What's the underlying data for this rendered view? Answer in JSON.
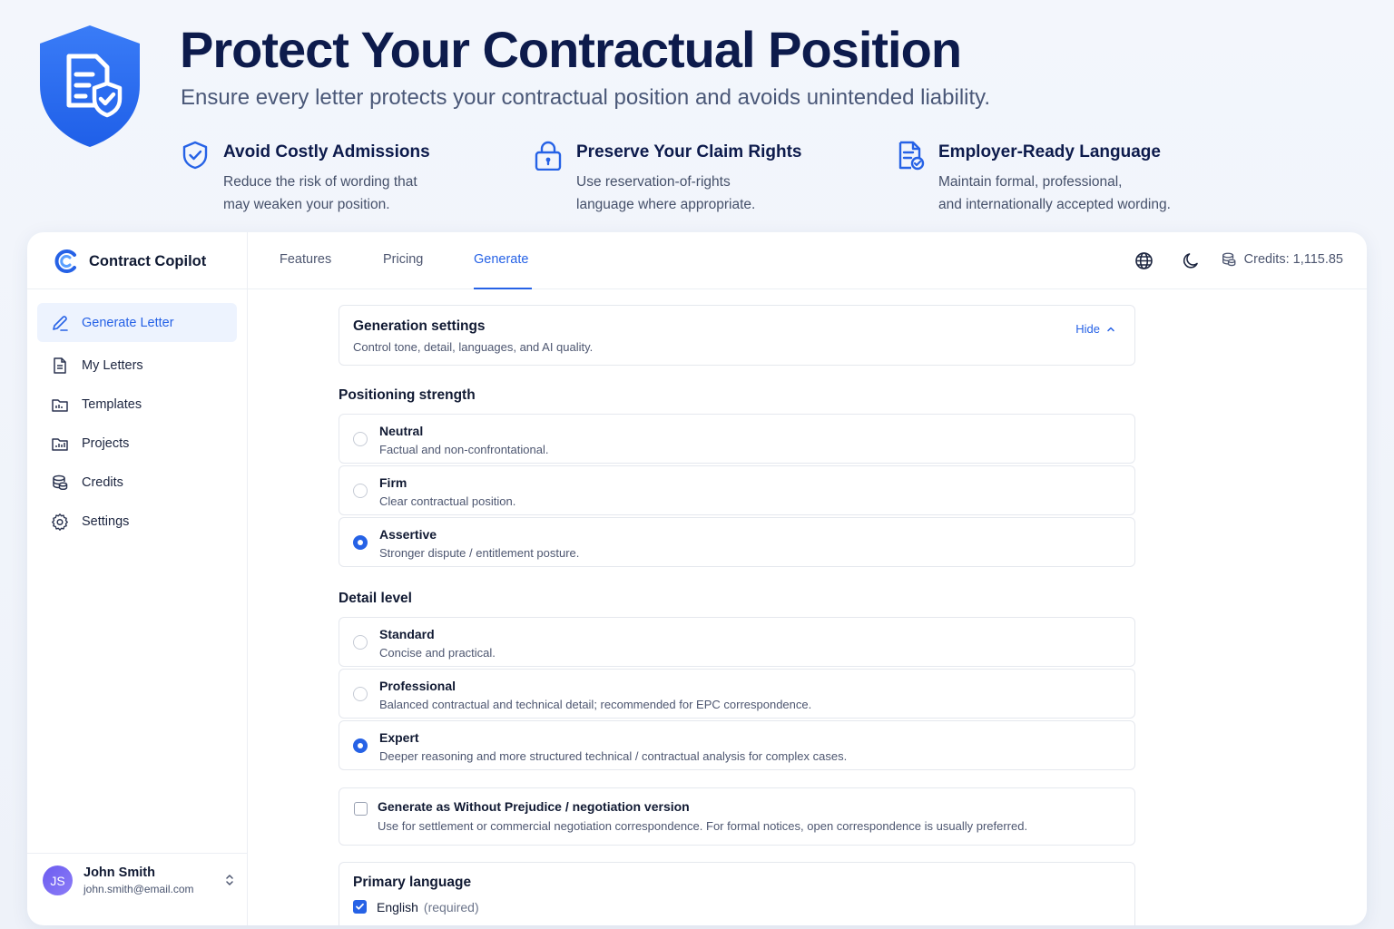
{
  "hero": {
    "title": "Protect Your Contractual Position",
    "subtitle": "Ensure every letter protects your contractual position and avoids unintended liability.",
    "features": [
      {
        "icon": "shield-check-icon",
        "title": "Avoid Costly Admissions",
        "desc_line1": "Reduce the risk of wording that",
        "desc_line2": "may weaken your position."
      },
      {
        "icon": "lock-icon",
        "title": "Preserve Your Claim Rights",
        "desc_line1": "Use reservation-of-rights",
        "desc_line2": "language where appropriate."
      },
      {
        "icon": "document-check-icon",
        "title": "Employer-Ready Language",
        "desc_line1": "Maintain formal, professional,",
        "desc_line2": "and internationally accepted wording."
      }
    ]
  },
  "brand": {
    "name": "Contract Copilot"
  },
  "sidebar": {
    "items": [
      {
        "label": "Generate Letter",
        "icon": "pen-icon",
        "active": true
      },
      {
        "label": "My Letters",
        "icon": "document-icon"
      },
      {
        "label": "Templates",
        "icon": "folder-icon"
      },
      {
        "label": "Projects",
        "icon": "folder-chart-icon"
      },
      {
        "label": "Credits",
        "icon": "coins-icon"
      },
      {
        "label": "Settings",
        "icon": "gear-icon"
      }
    ]
  },
  "user": {
    "initials": "JS",
    "name": "John Smith",
    "email": "john.smith@email.com"
  },
  "topbar": {
    "tabs": [
      {
        "label": "Features"
      },
      {
        "label": "Pricing"
      },
      {
        "label": "Generate",
        "active": true
      }
    ],
    "credits_label": "Credits: 1,115.85"
  },
  "generation_settings": {
    "title": "Generation settings",
    "subtitle": "Control tone, detail, languages, and AI quality.",
    "hide_label": "Hide"
  },
  "positioning": {
    "title": "Positioning strength",
    "options": [
      {
        "title": "Neutral",
        "desc": "Factual and non-confrontational.",
        "checked": false
      },
      {
        "title": "Firm",
        "desc": "Clear contractual position.",
        "checked": false
      },
      {
        "title": "Assertive",
        "desc": "Stronger dispute / entitlement posture.",
        "checked": true
      }
    ]
  },
  "detail": {
    "title": "Detail level",
    "options": [
      {
        "title": "Standard",
        "desc": "Concise and practical.",
        "checked": false
      },
      {
        "title": "Professional",
        "desc": "Balanced contractual and technical detail; recommended for EPC correspondence.",
        "checked": false
      },
      {
        "title": "Expert",
        "desc": "Deeper reasoning and more structured technical / contractual analysis for complex cases.",
        "checked": true
      }
    ]
  },
  "without_prejudice": {
    "title": "Generate as Without Prejudice / negotiation version",
    "desc": "Use for settlement or commercial negotiation correspondence. For formal notices, open correspondence is usually preferred.",
    "checked": false
  },
  "language": {
    "title": "Primary language",
    "option": "English",
    "note": "(required)",
    "checked": true
  },
  "colors": {
    "accent": "#2662e6",
    "heading": "#0d1b4c",
    "avatar": "#7a6cf4"
  }
}
